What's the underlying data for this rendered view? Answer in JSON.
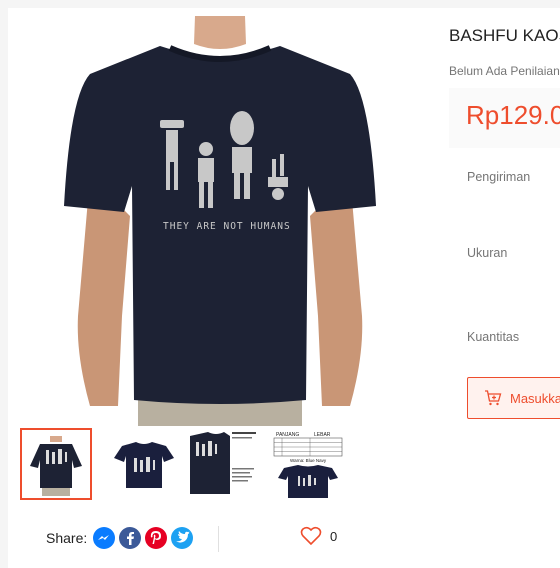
{
  "product": {
    "title": "BASHFU KAOS",
    "rating_text": "Belum Ada Penilaian",
    "price": "Rp129.0",
    "shirt_print_text": "THEY ARE NOT HUMANS"
  },
  "labels": {
    "shipping": "Pengiriman",
    "size": "Ukuran",
    "quantity": "Kuantitas"
  },
  "cart_button": {
    "label": "Masukka",
    "icon": "cart-plus-icon"
  },
  "share": {
    "label": "Share:",
    "icons": [
      "messenger-icon",
      "facebook-icon",
      "pinterest-icon",
      "twitter-icon"
    ]
  },
  "favorite": {
    "count": "0",
    "icon": "heart-icon"
  },
  "colors": {
    "accent": "#ee4d2d",
    "shirt": "#1d2234"
  },
  "thumbnails": [
    {
      "name": "thumbnail-1",
      "selected": true
    },
    {
      "name": "thumbnail-2",
      "selected": false
    },
    {
      "name": "thumbnail-3",
      "selected": false
    },
    {
      "name": "thumbnail-4",
      "selected": false
    }
  ],
  "size_chart_thumb": {
    "header_left": "PANJANG",
    "header_right": "LEBAR",
    "caption": "Warna: Blue Navy"
  }
}
